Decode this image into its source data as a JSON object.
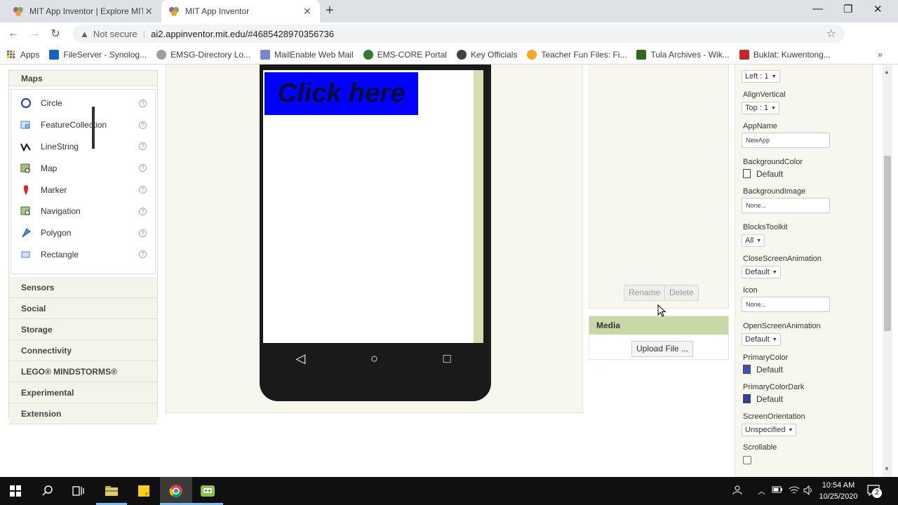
{
  "browser": {
    "tabs": [
      {
        "title": "MIT App Inventor | Explore MIT A",
        "active": false
      },
      {
        "title": "MIT App Inventor",
        "active": true
      }
    ],
    "not_secure": "Not secure",
    "url": "ai2.appinventor.mit.edu/#4685428970356736"
  },
  "bookmarks": [
    {
      "label": "Apps",
      "color": "#1a73e8"
    },
    {
      "label": "FileServer - Synolog...",
      "color": "#1565c0"
    },
    {
      "label": "EMSG-Directory Lo...",
      "color": "#9e9e9e"
    },
    {
      "label": "MailEnable Web Mail",
      "color": "#7986cb"
    },
    {
      "label": "EMS-CORE Portal",
      "color": "#2e7d32"
    },
    {
      "label": "Key Officials",
      "color": "#424242"
    },
    {
      "label": "Teacher Fun Files: Fi...",
      "color": "#f9a825"
    },
    {
      "label": "Tula Archives - Wik...",
      "color": "#33691e"
    },
    {
      "label": "Buklat: Kuwentong...",
      "color": "#c62828"
    }
  ],
  "palette": {
    "maps_header": "Maps",
    "maps_components": [
      {
        "label": "Circle",
        "icon": "circle-icon"
      },
      {
        "label": "FeatureCollection",
        "icon": "feature-collection-icon"
      },
      {
        "label": "LineString",
        "icon": "linestring-icon"
      },
      {
        "label": "Map",
        "icon": "map-icon"
      },
      {
        "label": "Marker",
        "icon": "marker-icon"
      },
      {
        "label": "Navigation",
        "icon": "navigation-icon"
      },
      {
        "label": "Polygon",
        "icon": "polygon-icon"
      },
      {
        "label": "Rectangle",
        "icon": "rectangle-icon"
      }
    ],
    "categories": [
      "Sensors",
      "Social",
      "Storage",
      "Connectivity",
      "LEGO® MINDSTORMS®",
      "Experimental",
      "Extension"
    ]
  },
  "viewer": {
    "button_text": "Click here",
    "button_color": "#0000ff"
  },
  "components": {
    "rename": "Rename",
    "delete": "Delete"
  },
  "media": {
    "title": "Media",
    "upload": "Upload File ..."
  },
  "properties": {
    "align_horizontal_value": "Left : 1",
    "align_vertical_label": "AlignVertical",
    "align_vertical_value": "Top : 1",
    "app_name_label": "AppName",
    "app_name_value": "NewApp",
    "background_color_label": "BackgroundColor",
    "background_color_value": "Default",
    "background_image_label": "BackgroundImage",
    "background_image_value": "None...",
    "blocks_toolkit_label": "BlocksToolkit",
    "blocks_toolkit_value": "All",
    "close_anim_label": "CloseScreenAnimation",
    "close_anim_value": "Default",
    "icon_label": "Icon",
    "icon_value": "None...",
    "open_anim_label": "OpenScreenAnimation",
    "open_anim_value": "Default",
    "primary_color_label": "PrimaryColor",
    "primary_color_value": "Default",
    "primary_color_dark_label": "PrimaryColorDark",
    "primary_color_dark_value": "Default",
    "orientation_label": "ScreenOrientation",
    "orientation_value": "Unspecified",
    "scrollable_label": "Scrollable",
    "primary_swatch": "#3f51b5",
    "primary_dark_swatch": "#303f9f"
  },
  "taskbar": {
    "time": "10:54 AM",
    "date": "10/25/2020",
    "notification_count": "2"
  }
}
